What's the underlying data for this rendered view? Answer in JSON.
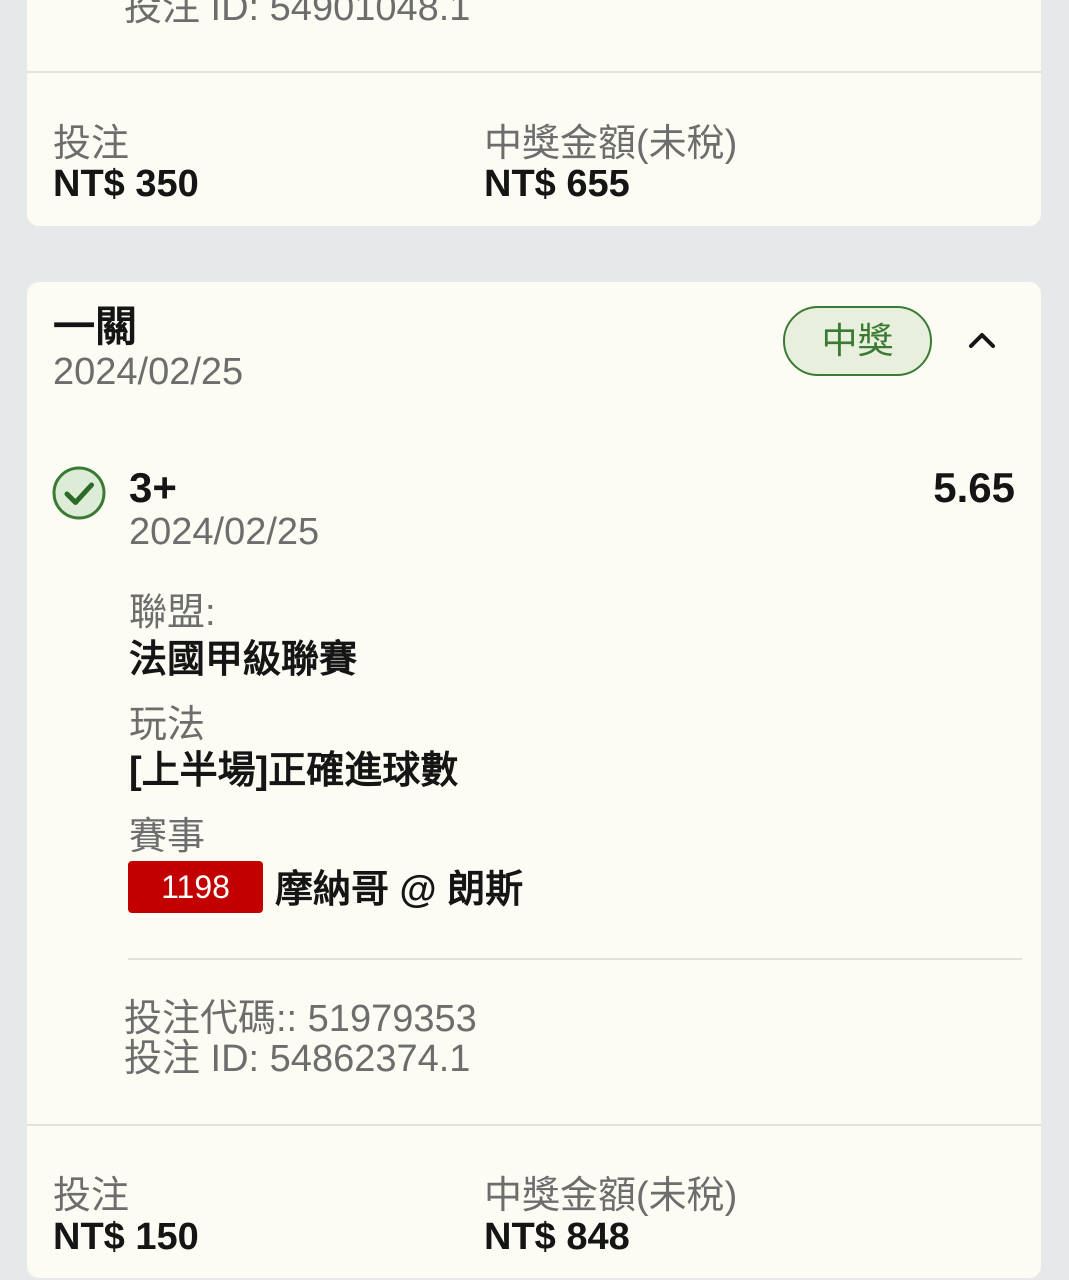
{
  "colors": {
    "background": "#e7e8ea",
    "card": "#fcfcf4",
    "text": "#151515",
    "muted": "#6d6d6d",
    "divider": "#e2e2da",
    "win_green": "#3b7a34",
    "win_green_bg": "#e8f0dd",
    "event_code_red": "#c20000"
  },
  "icons": {
    "selection_status": "check-circle-icon",
    "collapse_toggle": "chevron-up-icon"
  },
  "previous_bet": {
    "bet_id": "投注 ID: 54901048.1",
    "stake_label": "投注",
    "stake": "NT$ 350",
    "payout_label": "中獎金額(未稅)",
    "payout": "NT$ 655"
  },
  "bet": {
    "title": "一關",
    "date": "2024/02/25",
    "status": "中獎",
    "selection": {
      "pick": "3+",
      "odds": "5.65",
      "date": "2024/02/25",
      "league_label": "聯盟:",
      "league": "法國甲級聯賽",
      "market_label": "玩法",
      "market": "[上半場]正確進球數",
      "event_label": "賽事",
      "event_code": "1198",
      "event": "摩納哥 @ 朗斯"
    },
    "bet_code": "投注代碼:: 51979353",
    "bet_id": "投注 ID: 54862374.1",
    "stake_label": "投注",
    "stake": "NT$ 150",
    "payout_label": "中獎金額(未稅)",
    "payout": "NT$ 848"
  }
}
